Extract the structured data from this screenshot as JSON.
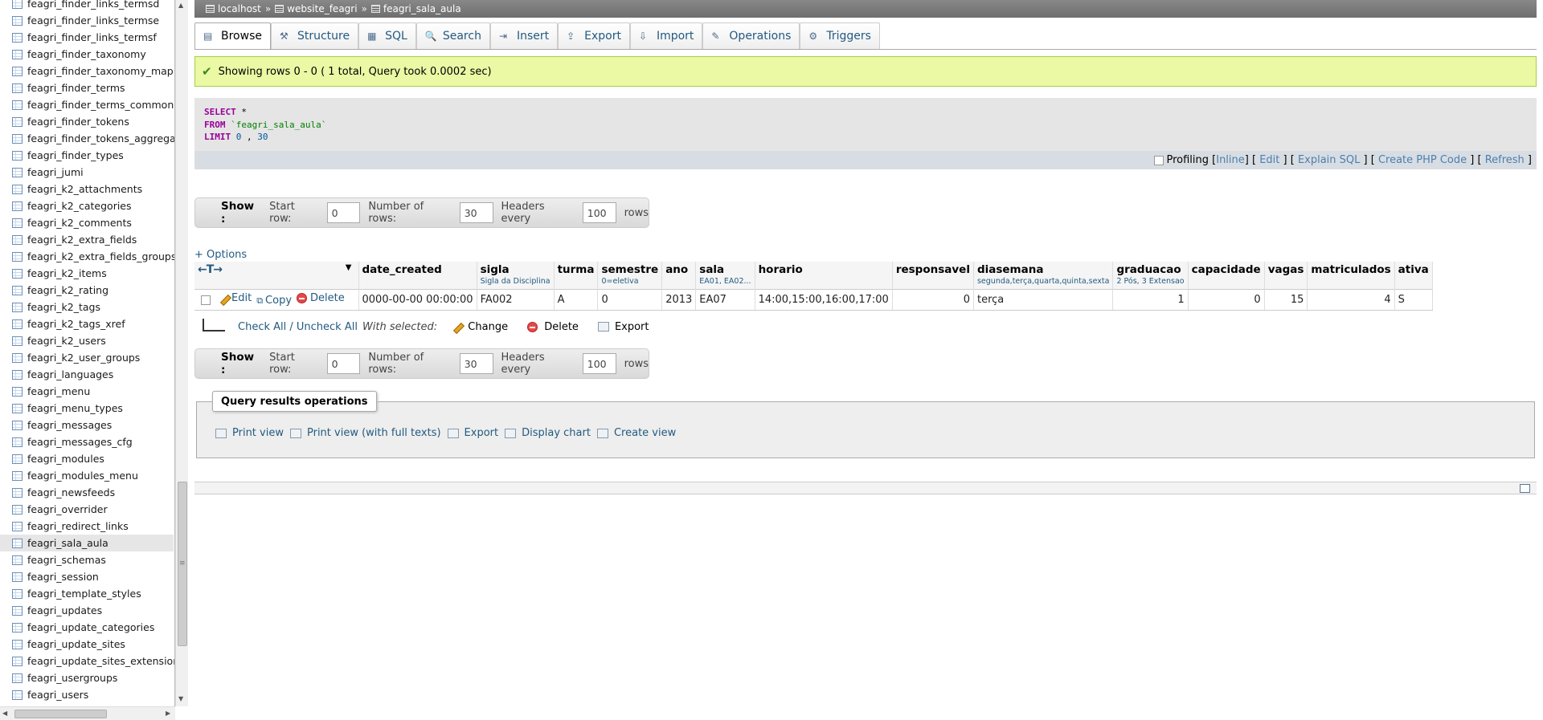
{
  "sidebar": {
    "tables": [
      "feagri_finder_links_termsd",
      "feagri_finder_links_termse",
      "feagri_finder_links_termsf",
      "feagri_finder_taxonomy",
      "feagri_finder_taxonomy_map",
      "feagri_finder_terms",
      "feagri_finder_terms_common",
      "feagri_finder_tokens",
      "feagri_finder_tokens_aggregate",
      "feagri_finder_types",
      "feagri_jumi",
      "feagri_k2_attachments",
      "feagri_k2_categories",
      "feagri_k2_comments",
      "feagri_k2_extra_fields",
      "feagri_k2_extra_fields_groups",
      "feagri_k2_items",
      "feagri_k2_rating",
      "feagri_k2_tags",
      "feagri_k2_tags_xref",
      "feagri_k2_users",
      "feagri_k2_user_groups",
      "feagri_languages",
      "feagri_menu",
      "feagri_menu_types",
      "feagri_messages",
      "feagri_messages_cfg",
      "feagri_modules",
      "feagri_modules_menu",
      "feagri_newsfeeds",
      "feagri_overrider",
      "feagri_redirect_links",
      "feagri_sala_aula",
      "feagri_schemas",
      "feagri_session",
      "feagri_template_styles",
      "feagri_updates",
      "feagri_update_categories",
      "feagri_update_sites",
      "feagri_update_sites_extensions",
      "feagri_usergroups",
      "feagri_users"
    ],
    "active_table": "feagri_sala_aula"
  },
  "breadcrumb": {
    "server": "localhost",
    "database": "website_feagri",
    "table": "feagri_sala_aula",
    "separator": "»"
  },
  "tabs": [
    {
      "label": "Browse",
      "icon": "browse-icon",
      "active": true
    },
    {
      "label": "Structure",
      "icon": "structure-icon"
    },
    {
      "label": "SQL",
      "icon": "sql-icon"
    },
    {
      "label": "Search",
      "icon": "search-icon"
    },
    {
      "label": "Insert",
      "icon": "insert-icon"
    },
    {
      "label": "Export",
      "icon": "export-icon"
    },
    {
      "label": "Import",
      "icon": "import-icon"
    },
    {
      "label": "Operations",
      "icon": "operations-icon"
    },
    {
      "label": "Triggers",
      "icon": "triggers-icon"
    }
  ],
  "notice": {
    "text": "Showing rows 0 - 0 ( 1 total, Query took 0.0002 sec)"
  },
  "sql": {
    "select_kw": "SELECT",
    "star": "*",
    "from_kw": "FROM",
    "table": "`feagri_sala_aula`",
    "limit_kw": "LIMIT",
    "limit_start": "0",
    "limit_sep": ",",
    "limit_count": "30"
  },
  "sql_links": {
    "profiling": "Profiling",
    "inline": "Inline",
    "edit": "Edit",
    "explain": "Explain SQL",
    "php": "Create PHP Code",
    "refresh": "Refresh"
  },
  "nav": {
    "show_label": "Show :",
    "start_row_label": "Start row:",
    "start_row_value": "0",
    "num_rows_label": "Number of rows:",
    "num_rows_value": "30",
    "headers_every_label": "Headers every",
    "headers_every_value": "100",
    "rows_label": "rows"
  },
  "options_link": "+ Options",
  "table": {
    "control_header": "←T→",
    "columns": [
      {
        "name": "date_created",
        "sub": ""
      },
      {
        "name": "sigla",
        "sub": "Sigla da Disciplina"
      },
      {
        "name": "turma",
        "sub": ""
      },
      {
        "name": "semestre",
        "sub": "0=eletiva"
      },
      {
        "name": "ano",
        "sub": ""
      },
      {
        "name": "sala",
        "sub": "EA01, EA02..."
      },
      {
        "name": "horario",
        "sub": ""
      },
      {
        "name": "responsavel",
        "sub": ""
      },
      {
        "name": "diasemana",
        "sub": "segunda,terça,quarta,quinta,sexta"
      },
      {
        "name": "graduacao",
        "sub": "2 Pós, 3 Extensao"
      },
      {
        "name": "capacidade",
        "sub": ""
      },
      {
        "name": "vagas",
        "sub": ""
      },
      {
        "name": "matriculados",
        "sub": ""
      },
      {
        "name": "ativa",
        "sub": ""
      }
    ],
    "row_actions": {
      "edit": "Edit",
      "copy": "Copy",
      "delete": "Delete"
    },
    "rows": [
      [
        "0000-00-00 00:00:00",
        "FA002",
        "A",
        "0",
        "2013",
        "EA07",
        "14:00,15:00,16:00,17:00",
        "0",
        "terça",
        "1",
        "0",
        "15",
        "4",
        "S"
      ]
    ]
  },
  "with_selected": {
    "check_all": "Check All / Uncheck All",
    "label": "With selected:",
    "change": "Change",
    "delete": "Delete",
    "export": "Export"
  },
  "query_ops": {
    "title": "Query results operations",
    "print_view": "Print view",
    "print_view_full": "Print view (with full texts)",
    "export": "Export",
    "display_chart": "Display chart",
    "create_view": "Create view"
  }
}
